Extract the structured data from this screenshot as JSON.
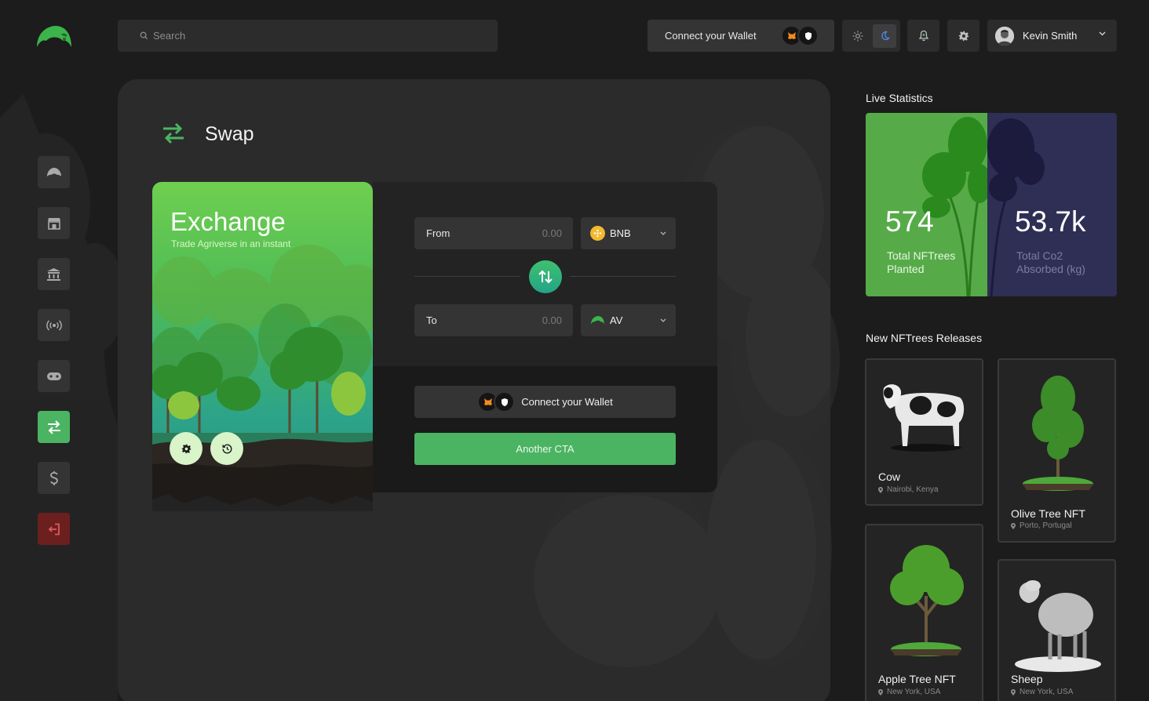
{
  "search": {
    "placeholder": "Search"
  },
  "header": {
    "connect_wallet_label": "Connect your Wallet",
    "user_name": "Kevin Smith"
  },
  "icons": {
    "logo": "leaf-umbrella-logo",
    "search": "search-icon",
    "light_mode": "sun-icon",
    "dark_mode": "moon-icon",
    "notifications": "bell-icon",
    "settings": "gear-icon",
    "sidebar": [
      "umbrella-icon",
      "store-icon",
      "bank-icon",
      "broadcast-icon",
      "gamepad-icon",
      "swap-icon",
      "dollar-icon",
      "logout-icon"
    ]
  },
  "swap": {
    "title": "Swap",
    "card_title": "Exchange",
    "card_subtitle": "Trade Agriverse in an instant",
    "from_label": "From",
    "from_value": "0.00",
    "from_token": "BNB",
    "to_label": "To",
    "to_value": "0.00",
    "to_token": "AV",
    "connect_wallet_label": "Connect your Wallet",
    "another_cta_label": "Another CTA"
  },
  "live_stats": {
    "title": "Live Statistics",
    "planted_value": "574",
    "planted_label": "Total NFTrees Planted",
    "co2_value": "53.7k",
    "co2_label": "Total Co2 Absorbed (kg)"
  },
  "releases": {
    "title": "New NFTrees Releases",
    "items": [
      {
        "name": "Cow",
        "location": "Nairobi, Kenya"
      },
      {
        "name": "Olive Tree NFT",
        "location": "Porto, Portugal"
      },
      {
        "name": "Apple Tree NFT",
        "location": "New York, USA"
      },
      {
        "name": "Sheep",
        "location": "New York, USA"
      }
    ]
  },
  "colors": {
    "accent_green": "#4bb462",
    "logout_red": "#6b1f1f",
    "stat_purple": "#2f2e55",
    "stat_green": "#56ab48"
  }
}
